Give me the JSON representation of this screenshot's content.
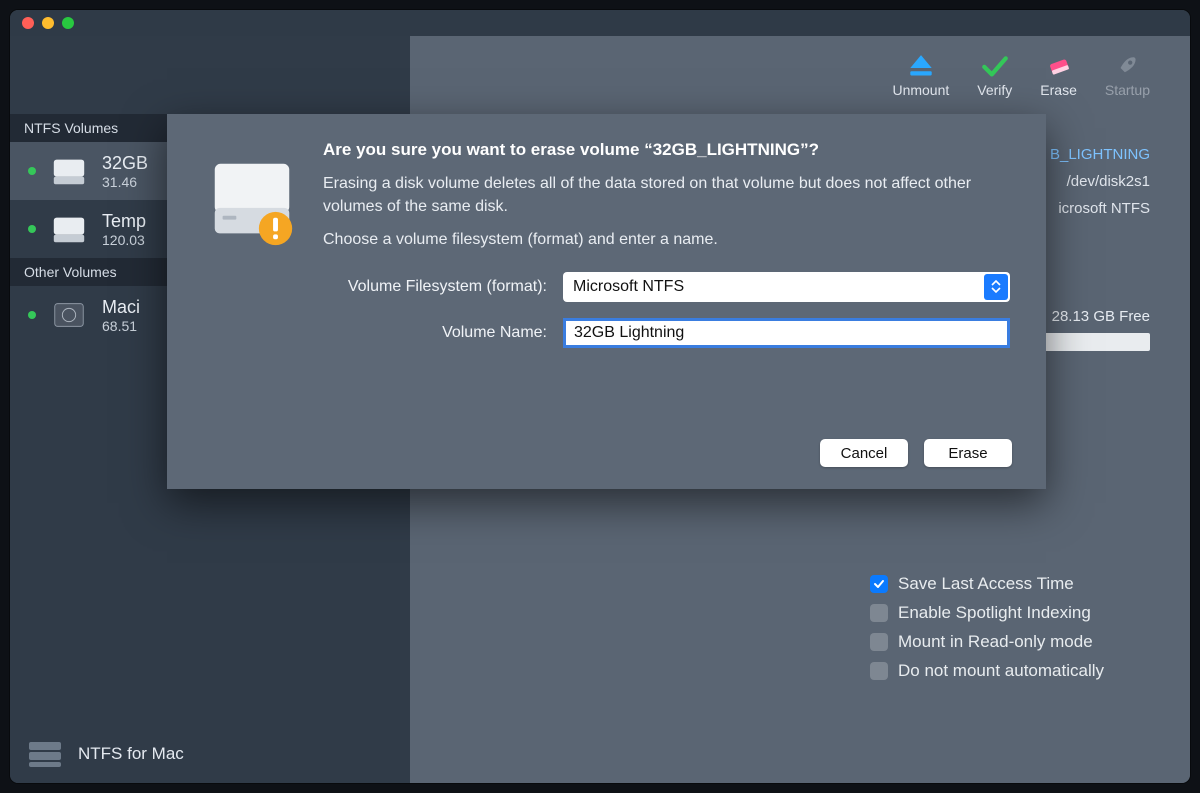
{
  "toolbar": {
    "unmount": "Unmount",
    "verify": "Verify",
    "erase": "Erase",
    "startup": "Startup"
  },
  "sidebar": {
    "section_ntfs": "NTFS Volumes",
    "section_other": "Other Volumes",
    "items": [
      {
        "name": "32GB",
        "sub": "31.46"
      },
      {
        "name": "Temp",
        "sub": "120.03"
      },
      {
        "name": "Maci",
        "sub": "68.51"
      }
    ]
  },
  "info": {
    "vol_name": "B_LIGHTNING",
    "mount_point": "/dev/disk2s1",
    "filesystem": "icrosoft NTFS"
  },
  "usage": {
    "free_label": "28.13 GB Free"
  },
  "options": {
    "save_last_access": "Save Last Access Time",
    "spotlight": "Enable Spotlight Indexing",
    "readonly": "Mount in Read-only mode",
    "no_automount": "Do not mount automatically"
  },
  "modal": {
    "title": "Are you sure you want to erase volume “32GB_LIGHTNING”?",
    "desc1": "Erasing a disk volume deletes all of the data stored on that volume but does not affect other volumes of the same disk.",
    "desc2": "Choose a volume filesystem (format) and enter a name.",
    "format_label": "Volume Filesystem (format):",
    "name_label": "Volume Name:",
    "format_value": "Microsoft NTFS",
    "name_value": "32GB Lightning",
    "cancel": "Cancel",
    "erase": "Erase"
  },
  "footer": {
    "app_name": "NTFS for Mac"
  }
}
